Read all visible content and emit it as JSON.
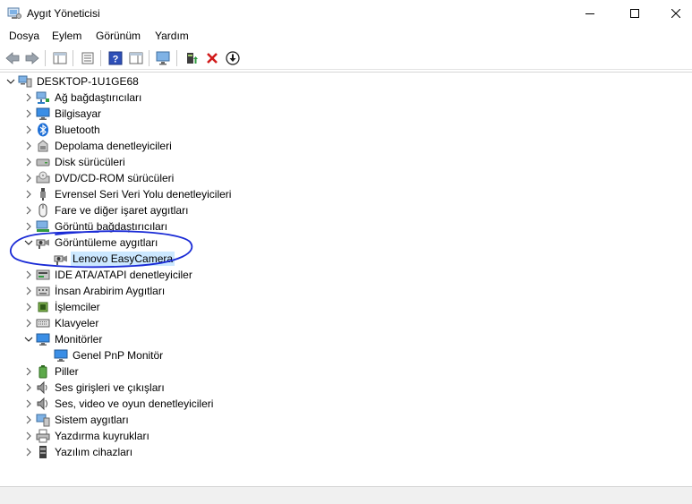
{
  "window": {
    "title": "Aygıt Yöneticisi"
  },
  "menu": [
    "Dosya",
    "Eylem",
    "Görünüm",
    "Yardım"
  ],
  "toolbar": {
    "icons": [
      "back-arrow-icon",
      "forward-arrow-icon",
      "properties-pane-icon",
      "device-view-icon",
      "help-icon",
      "action-pane-icon",
      "monitor-scan-icon",
      "update-driver-icon",
      "uninstall-x-icon",
      "download-icon"
    ]
  },
  "tree": {
    "root": "DESKTOP-1U1GE68",
    "items": [
      {
        "label": "Ağ bağdaştırıcıları",
        "icon": "network-adapter-icon",
        "expanded": false
      },
      {
        "label": "Bilgisayar",
        "icon": "computer-icon",
        "expanded": false
      },
      {
        "label": "Bluetooth",
        "icon": "bluetooth-icon",
        "expanded": false
      },
      {
        "label": "Depolama denetleyicileri",
        "icon": "storage-controller-icon",
        "expanded": false
      },
      {
        "label": "Disk sürücüleri",
        "icon": "disk-drive-icon",
        "expanded": false
      },
      {
        "label": "DVD/CD-ROM sürücüleri",
        "icon": "dvd-drive-icon",
        "expanded": false
      },
      {
        "label": "Evrensel Seri Veri Yolu denetleyicileri",
        "icon": "usb-icon",
        "expanded": false
      },
      {
        "label": "Fare ve diğer işaret aygıtları",
        "icon": "mouse-icon",
        "expanded": false
      },
      {
        "label": "Görüntü bağdaştırıcıları",
        "icon": "display-adapter-icon",
        "expanded": false
      },
      {
        "label": "Görüntüleme aygıtları",
        "icon": "camera-icon",
        "expanded": true,
        "children": [
          {
            "label": "Lenovo EasyCamera",
            "icon": "camera-icon",
            "selected": true
          }
        ]
      },
      {
        "label": "IDE ATA/ATAPI denetleyiciler",
        "icon": "ide-controller-icon",
        "expanded": false
      },
      {
        "label": "İnsan Arabirim Aygıtları",
        "icon": "hid-icon",
        "expanded": false
      },
      {
        "label": "İşlemciler",
        "icon": "processor-icon",
        "expanded": false
      },
      {
        "label": "Klavyeler",
        "icon": "keyboard-icon",
        "expanded": false
      },
      {
        "label": "Monitörler",
        "icon": "monitor-icon",
        "expanded": true,
        "children": [
          {
            "label": "Genel PnP Monitör",
            "icon": "monitor-icon",
            "selected": false
          }
        ]
      },
      {
        "label": "Piller",
        "icon": "battery-icon",
        "expanded": false
      },
      {
        "label": "Ses girişleri ve çıkışları",
        "icon": "speaker-icon",
        "expanded": false
      },
      {
        "label": "Ses, video ve oyun denetleyicileri",
        "icon": "sound-controller-icon",
        "expanded": false
      },
      {
        "label": "Sistem aygıtları",
        "icon": "system-device-icon",
        "expanded": false
      },
      {
        "label": "Yazdırma kuyrukları",
        "icon": "printer-icon",
        "expanded": false
      },
      {
        "label": "Yazılım cihazları",
        "icon": "software-device-icon",
        "expanded": false
      }
    ]
  },
  "colors": {
    "selection": "#cce8ff",
    "annotation": "#1a2bd6"
  }
}
